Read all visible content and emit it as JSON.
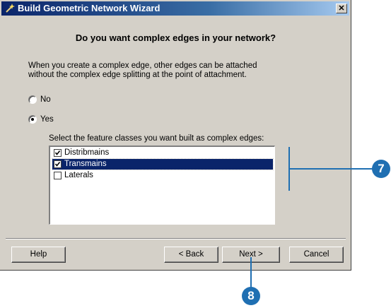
{
  "window": {
    "title": "Build Geometric Network Wizard",
    "close_glyph": "✕"
  },
  "heading": "Do you want complex edges in your network?",
  "description": [
    "When you create a complex edge, other edges can be attached",
    "without the complex edge splitting at the point of attachment."
  ],
  "options": {
    "no_label": "No",
    "yes_label": "Yes",
    "selected": "Yes"
  },
  "feature_classes": {
    "label": "Select the feature classes you want built as complex edges:",
    "items": [
      {
        "label": "Distribmains",
        "checked": true,
        "selected": false
      },
      {
        "label": "Transmains",
        "checked": true,
        "selected": true
      },
      {
        "label": "Laterals",
        "checked": false,
        "selected": false
      }
    ]
  },
  "buttons": {
    "help": "Help",
    "back": "< Back",
    "next": "Next >",
    "cancel": "Cancel"
  },
  "callouts": {
    "step7": "7",
    "step8": "8"
  },
  "colors": {
    "callout": "#1f6fb2",
    "selection": "#0a246a"
  }
}
